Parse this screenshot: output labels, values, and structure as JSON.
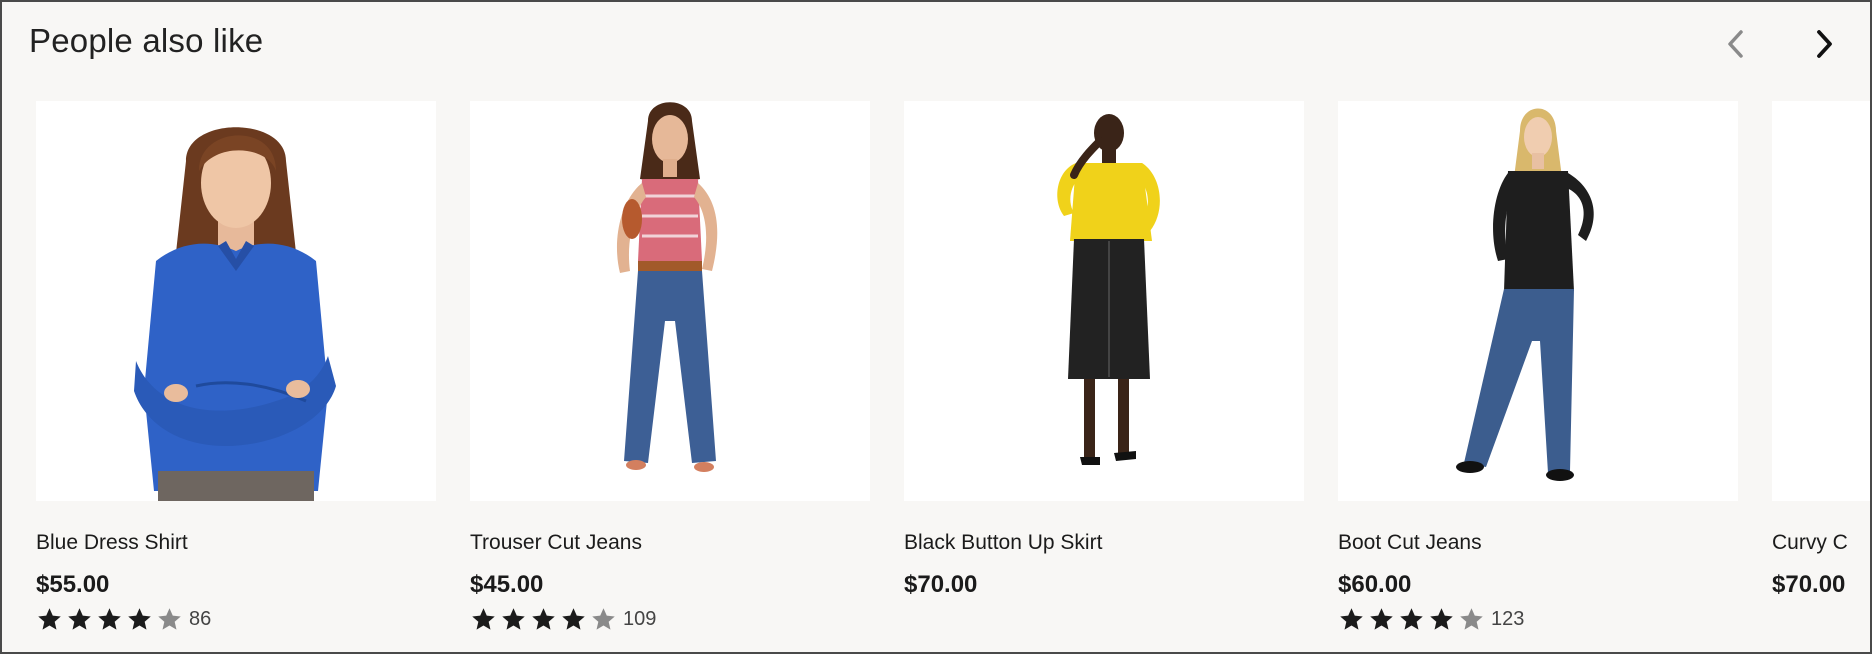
{
  "header": {
    "title": "People also like",
    "prev_icon": "chevron-left-icon",
    "next_icon": "chevron-right-icon"
  },
  "colors": {
    "background": "#f8f7f5",
    "star_filled": "#1b1b1b",
    "star_empty": "#8a8a8a",
    "prev_chevron": "#8a8a8a",
    "next_chevron": "#111111"
  },
  "products": [
    {
      "name": "Blue Dress Shirt",
      "price": "$55.00",
      "rating": 4,
      "rating_max": 5,
      "review_count": "86",
      "image": "woman-blue-shirt"
    },
    {
      "name": "Trouser Cut Jeans",
      "price": "$45.00",
      "rating": 4,
      "rating_max": 5,
      "review_count": "109",
      "image": "woman-red-top-jeans"
    },
    {
      "name": "Black Button Up Skirt",
      "price": "$70.00",
      "rating": null,
      "rating_max": 5,
      "review_count": null,
      "image": "woman-yellow-blouse-black-skirt"
    },
    {
      "name": "Boot Cut Jeans",
      "price": "$60.00",
      "rating": 4,
      "rating_max": 5,
      "review_count": "123",
      "image": "woman-black-top-jeans"
    },
    {
      "name": "Curvy C",
      "price": "$70.00",
      "rating": null,
      "rating_max": 5,
      "review_count": null,
      "image": "partial-product"
    }
  ]
}
